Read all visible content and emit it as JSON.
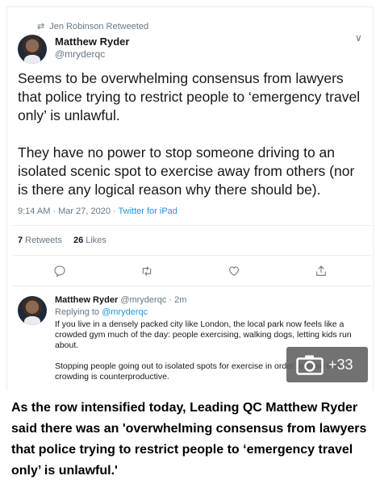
{
  "tweet": {
    "retweet_line": "Jen Robinson Retweeted",
    "author_name": "Matthew Ryder",
    "author_handle": "@mryderqc",
    "text_p1": "Seems to be overwhelming consensus from lawyers that police trying to restrict people to ‘emergency travel only’ is unlawful.",
    "text_p2": "They have no power to stop someone driving to an isolated scenic spot to exercise away from others (nor is there any logical reason why there should be).",
    "time": "9:14 AM · Mar 27, 2020 · ",
    "source": "Twitter for iPad",
    "retweets_count": "7",
    "retweets_label": "Retweets",
    "likes_count": "26",
    "likes_label": "Likes"
  },
  "reply": {
    "author_name": "Matthew Ryder",
    "author_handle": "@mryderqc · 2m",
    "replying_prefix": "Replying to ",
    "replying_to": "@mryderqc",
    "text_p1": "If you live in a densely packed city like London, the local park now feels like a crowded gym much of the day: people exercising, walking dogs, letting kids run about.",
    "text_p2": "Stopping people going out to isolated spots for exercise in order to ease that crowding is counterproductive."
  },
  "gallery": {
    "count_label": "+33",
    "icon": "camera-icon"
  },
  "caption": "As the row intensified today, Leading QC Matthew Ryder said there was an 'overwhelming consensus from lawyers that police trying to restrict people to ‘emergency travel only’ is unlawful.'",
  "icons": {
    "retweet_indicator": "retweet-icon",
    "menu": "chevron-down-icon",
    "reply": "reply-icon",
    "retweet": "retweet-icon",
    "like": "heart-icon",
    "share": "share-icon"
  },
  "colors": {
    "link": "#1b95e0",
    "muted": "#657786",
    "text": "#14171a"
  }
}
